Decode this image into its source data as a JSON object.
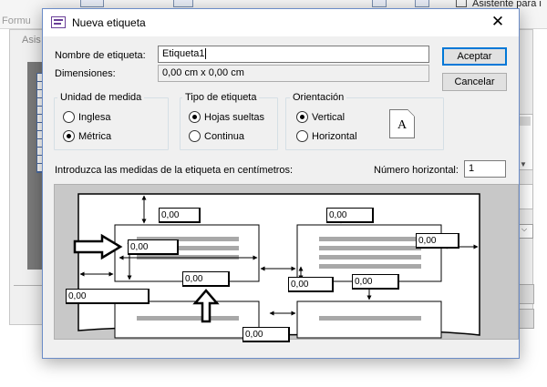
{
  "background": {
    "ribbon_tab": "Formu",
    "wizard_tab": "Asis",
    "assistant": "Asistente para i"
  },
  "dialog": {
    "title": "Nueva etiqueta",
    "close_glyph": "✕",
    "name_label": "Nombre de etiqueta:",
    "name_value": "Etiqueta1",
    "dimensions_label": "Dimensiones:",
    "dimensions_value": "0,00 cm x 0,00 cm",
    "accept_label": "Aceptar",
    "cancel_label": "Cancelar",
    "units": {
      "title": "Unidad de medida",
      "options": [
        {
          "label": "Inglesa",
          "selected": false
        },
        {
          "label": "Métrica",
          "selected": true
        }
      ]
    },
    "label_type": {
      "title": "Tipo de etiqueta",
      "options": [
        {
          "label": "Hojas sueltas",
          "selected": true
        },
        {
          "label": "Continua",
          "selected": false
        }
      ]
    },
    "orientation": {
      "title": "Orientación",
      "options": [
        {
          "label": "Vertical",
          "selected": true
        },
        {
          "label": "Horizontal",
          "selected": false
        }
      ],
      "preview_letter": "A"
    },
    "measure_instruction": "Introduzca las medidas de la etiqueta en centímetros:",
    "horizontal_count_label": "Número horizontal:",
    "horizontal_count_value": "1",
    "diagram_values": [
      "0,00",
      "0,00",
      "0,00",
      "0,00",
      "0,00",
      "0,00",
      "0,00",
      "0,00",
      "0,00"
    ]
  }
}
